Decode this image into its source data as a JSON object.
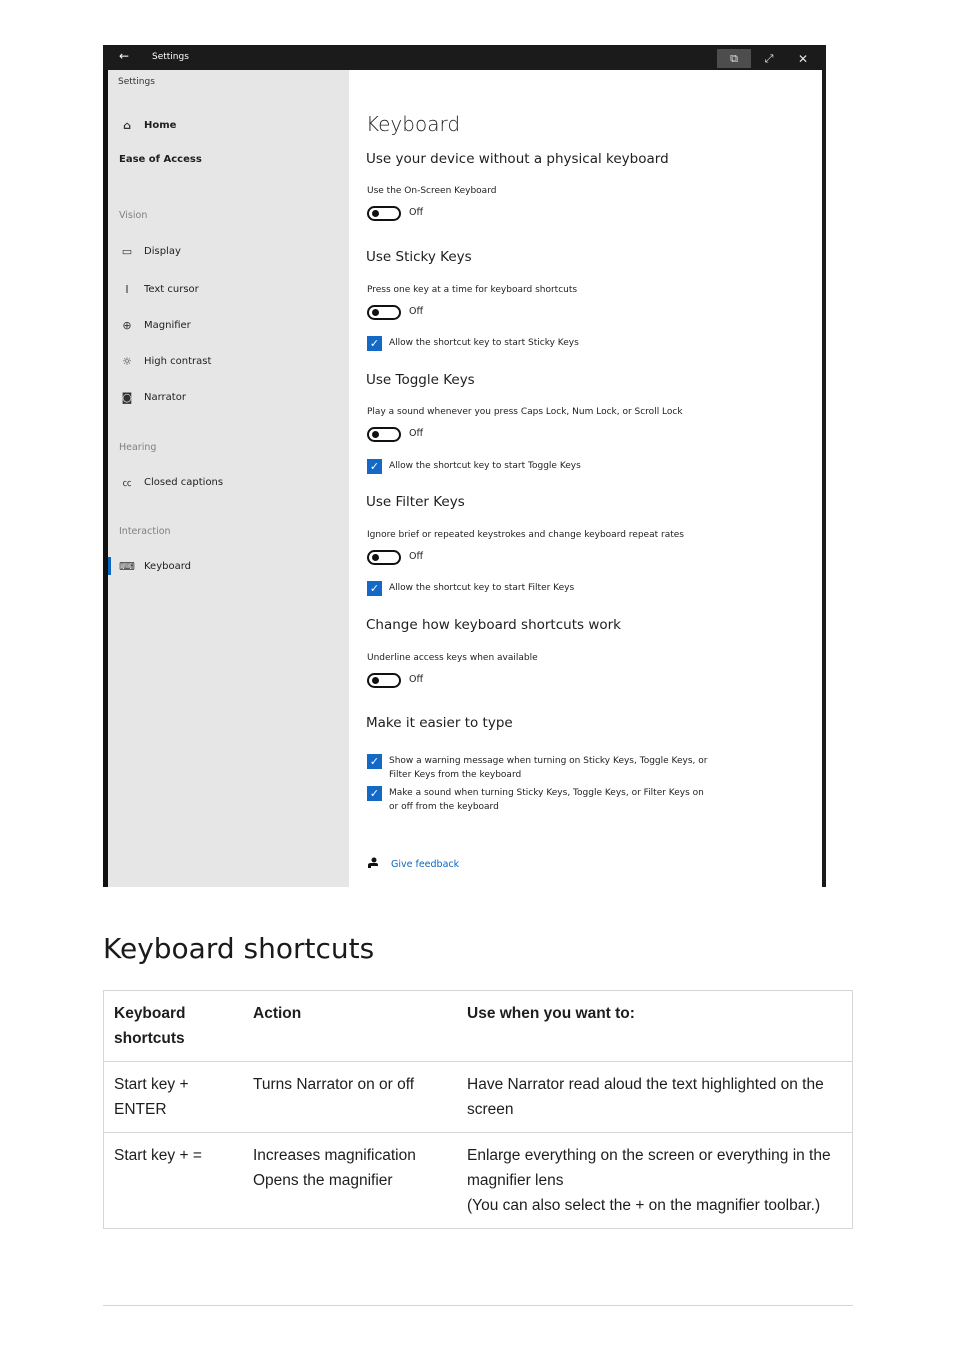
{
  "window": {
    "title": "Settings",
    "controls": {
      "restore": "restore-icon",
      "maximize": "maximize-icon",
      "close": "close-icon"
    },
    "icons": {
      "back": "←",
      "restore": "⧉",
      "maximize": "⤢",
      "close": "✕"
    }
  },
  "sidebar": {
    "breadcrumb": "Settings",
    "home": {
      "label": "Home",
      "icon": "⌂"
    },
    "section_title": "Ease of Access",
    "groups": [
      {
        "label": "Vision",
        "items": [
          {
            "label": "Display",
            "icon": "▭"
          },
          {
            "label": "Text cursor",
            "icon": "I"
          },
          {
            "label": "Magnifier",
            "icon": "⊕"
          },
          {
            "label": "High contrast",
            "icon": "☼"
          },
          {
            "label": "Narrator",
            "icon": "◙"
          }
        ]
      },
      {
        "label": "Hearing",
        "items": [
          {
            "label": "Closed captions",
            "icon": "㏄"
          }
        ]
      },
      {
        "label": "Interaction",
        "items": [
          {
            "label": "Keyboard",
            "icon": "⌨",
            "selected": true
          }
        ]
      }
    ]
  },
  "content": {
    "title": "Keyboard",
    "sections": {
      "onscreen": {
        "heading": "Use your device without a physical keyboard",
        "setting": "Use the On-Screen Keyboard",
        "toggle": "Off"
      },
      "sticky": {
        "heading": "Use Sticky Keys",
        "setting": "Press one key at a time for keyboard shortcuts",
        "toggle": "Off",
        "checkbox": "Allow the shortcut key to start Sticky Keys",
        "checked": true
      },
      "toggle_keys": {
        "heading": "Use Toggle Keys",
        "setting": "Play a sound whenever you press Caps Lock, Num Lock, or Scroll Lock",
        "toggle": "Off",
        "checkbox": "Allow the shortcut key to start Toggle Keys",
        "checked": true
      },
      "filter": {
        "heading": "Use Filter Keys",
        "setting": "Ignore brief or repeated keystrokes and change keyboard repeat rates",
        "toggle": "Off",
        "checkbox": "Allow the shortcut key to start Filter Keys",
        "checked": true
      },
      "shortcuts": {
        "heading": "Change how keyboard shortcuts work",
        "setting": "Underline access keys when available",
        "toggle": "Off"
      },
      "easier": {
        "heading": "Make it easier to type",
        "checkboxes": [
          {
            "label": "Show a warning message when turning on Sticky Keys, Toggle Keys, or Filter Keys from the keyboard",
            "checked": true
          },
          {
            "label": "Make a sound when turning Sticky Keys, Toggle Keys, or Filter Keys on or off from the keyboard",
            "checked": true
          }
        ]
      }
    },
    "feedback": {
      "icon": "feedback-icon",
      "label": "Give feedback"
    },
    "check_glyph": "✓"
  },
  "doc": {
    "heading": "Keyboard shortcuts",
    "table": {
      "headers": [
        "Keyboard shortcuts",
        "Action",
        "Use when you want to:"
      ],
      "rows": [
        {
          "shortcut": [
            "Start key +",
            "ENTER"
          ],
          "action": [
            "Turns Narrator on or off"
          ],
          "use": [
            "Have Narrator read aloud the text highlighted on the screen"
          ]
        },
        {
          "shortcut": [
            "Start key + ="
          ],
          "action": [
            "Increases magnification",
            "Opens the magnifier"
          ],
          "use": [
            "Enlarge everything on the screen or everything in the magnifier lens",
            "(You can also select the + on the magnifier toolbar.)"
          ]
        }
      ]
    }
  },
  "colors": {
    "accent": "#0a67c2",
    "checkbox": "#1469c7",
    "sidebar_bg": "#e6e6e6",
    "titlebar_bg": "#1b1b1b"
  }
}
